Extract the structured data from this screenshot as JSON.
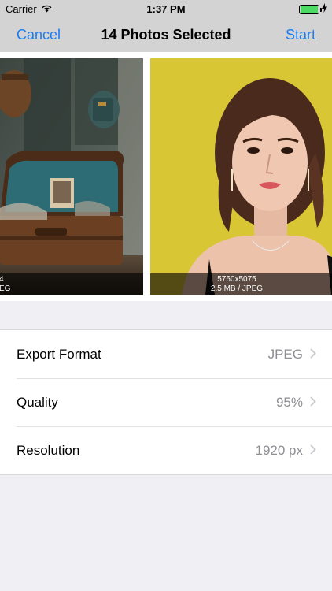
{
  "status_bar": {
    "carrier": "Carrier",
    "time": "1:37 PM",
    "wifi_icon": "wifi-icon",
    "battery_icon": "battery-icon",
    "battery_level": 1.0,
    "charging_icon": "charging-bolt-icon",
    "battery_color": "#4cd964"
  },
  "nav": {
    "cancel_label": "Cancel",
    "title": "14 Photos Selected",
    "start_label": "Start",
    "tint_color": "#1a7cf4"
  },
  "photos": [
    {
      "overlay_line1": "4",
      "overlay_line2": "EG"
    },
    {
      "overlay_line1": "5760x5075",
      "overlay_line2": "2.5 MB / JPEG"
    }
  ],
  "settings": [
    {
      "label": "Export Format",
      "value": "JPEG"
    },
    {
      "label": "Quality",
      "value": "95%"
    },
    {
      "label": "Resolution",
      "value": "1920 px"
    }
  ],
  "chevron_icon": "chevron-right-icon"
}
